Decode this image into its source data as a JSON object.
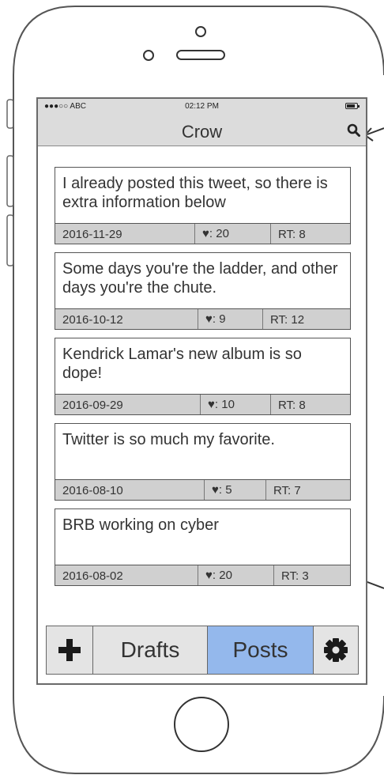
{
  "status_bar": {
    "carrier": "●●●○○ ABC",
    "time": "02:12 PM"
  },
  "nav": {
    "title": "Crow"
  },
  "posts": [
    {
      "text": "I already posted this tweet, so there is extra information below",
      "date": "2016-11-29",
      "likes": "♥: 20",
      "retweets": "RT: 8"
    },
    {
      "text": "Some days you're the ladder, and other days you're the chute.",
      "date": "2016-10-12",
      "likes": "♥: 9",
      "retweets": "RT: 12"
    },
    {
      "text": "Kendrick Lamar's new album is so dope!",
      "date": "2016-09-29",
      "likes": "♥: 10",
      "retweets": "RT: 8"
    },
    {
      "text": "Twitter is so much my favorite.",
      "date": "2016-08-10",
      "likes": "♥: 5",
      "retweets": "RT: 7"
    },
    {
      "text": "BRB working on cyber",
      "date": "2016-08-02",
      "likes": "♥: 20",
      "retweets": "RT: 3"
    }
  ],
  "tabs": {
    "drafts": "Drafts",
    "posts": "Posts",
    "active": "Posts"
  },
  "colors": {
    "active_tab": "#94b8ec",
    "bar": "#dcdcdc",
    "meta": "#d0d0d0"
  },
  "icons": {
    "add": "plus-icon",
    "search": "search-icon",
    "settings": "gear-icon"
  }
}
